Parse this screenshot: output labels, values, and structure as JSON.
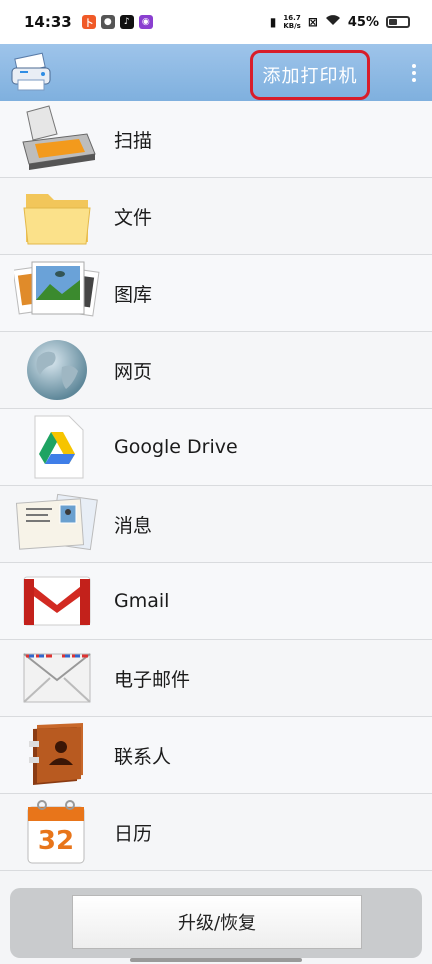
{
  "status_bar": {
    "time": "14:33",
    "net_speed_top": "16.7",
    "net_speed_bottom": "KB/s",
    "battery": "45%",
    "battery_level": 0.45
  },
  "app_bar": {
    "add_printer_label": "添加打印机"
  },
  "menu_items": [
    {
      "label": "扫描",
      "icon": "scanner-icon"
    },
    {
      "label": "文件",
      "icon": "folder-icon"
    },
    {
      "label": "图库",
      "icon": "gallery-icon"
    },
    {
      "label": "网页",
      "icon": "globe-icon"
    },
    {
      "label": "Google Drive",
      "icon": "google-drive-icon"
    },
    {
      "label": "消息",
      "icon": "messages-icon"
    },
    {
      "label": "Gmail",
      "icon": "gmail-icon"
    },
    {
      "label": "电子邮件",
      "icon": "email-icon"
    },
    {
      "label": "联系人",
      "icon": "contacts-icon"
    },
    {
      "label": "日历",
      "icon": "calendar-icon"
    }
  ],
  "calendar_day": "32",
  "upgrade_label": "升级/恢复"
}
